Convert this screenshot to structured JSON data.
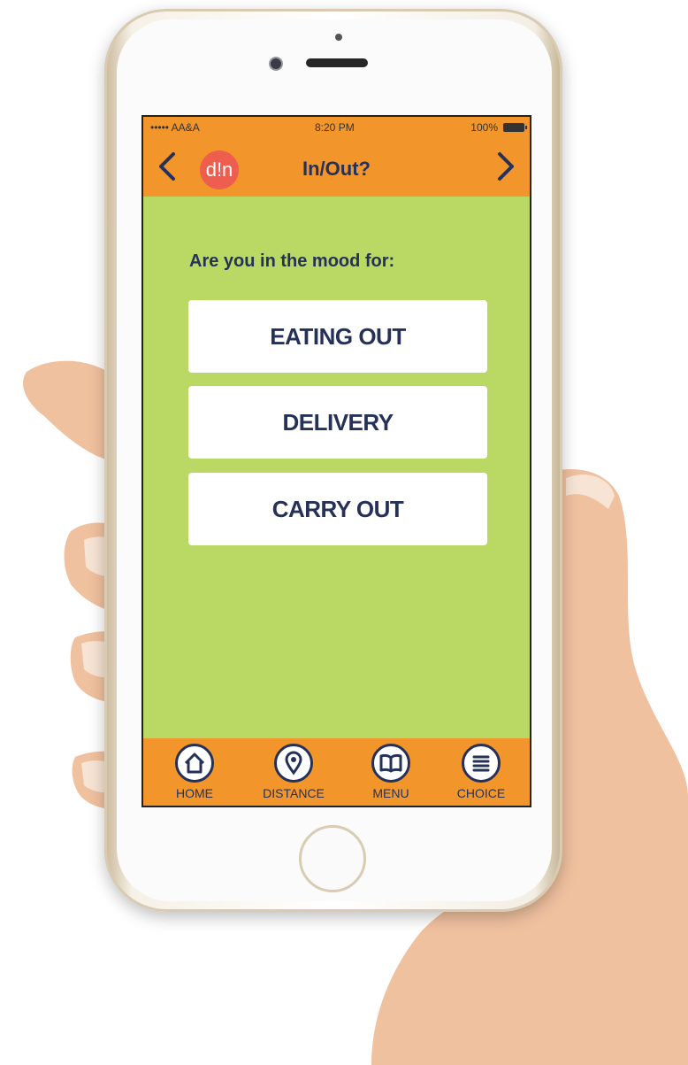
{
  "status_bar": {
    "carrier": "••••• AA&A",
    "time": "8:20 PM",
    "battery": "100%"
  },
  "nav": {
    "title": "In/Out?",
    "logo_text": "d!n"
  },
  "main": {
    "prompt": "Are you in the mood for:",
    "options": [
      {
        "label": "EATING OUT"
      },
      {
        "label": "DELIVERY"
      },
      {
        "label": "CARRY OUT"
      }
    ]
  },
  "tabbar": {
    "tabs": [
      {
        "label": "HOME",
        "icon": "home-icon"
      },
      {
        "label": "DISTANCE",
        "icon": "location-pin-icon"
      },
      {
        "label": "MENU",
        "icon": "book-icon"
      },
      {
        "label": "CHOICE",
        "icon": "list-icon"
      }
    ]
  },
  "colors": {
    "orange": "#f2962b",
    "green": "#bad964",
    "navy": "#263159",
    "logo_red": "#ee5e4f"
  }
}
